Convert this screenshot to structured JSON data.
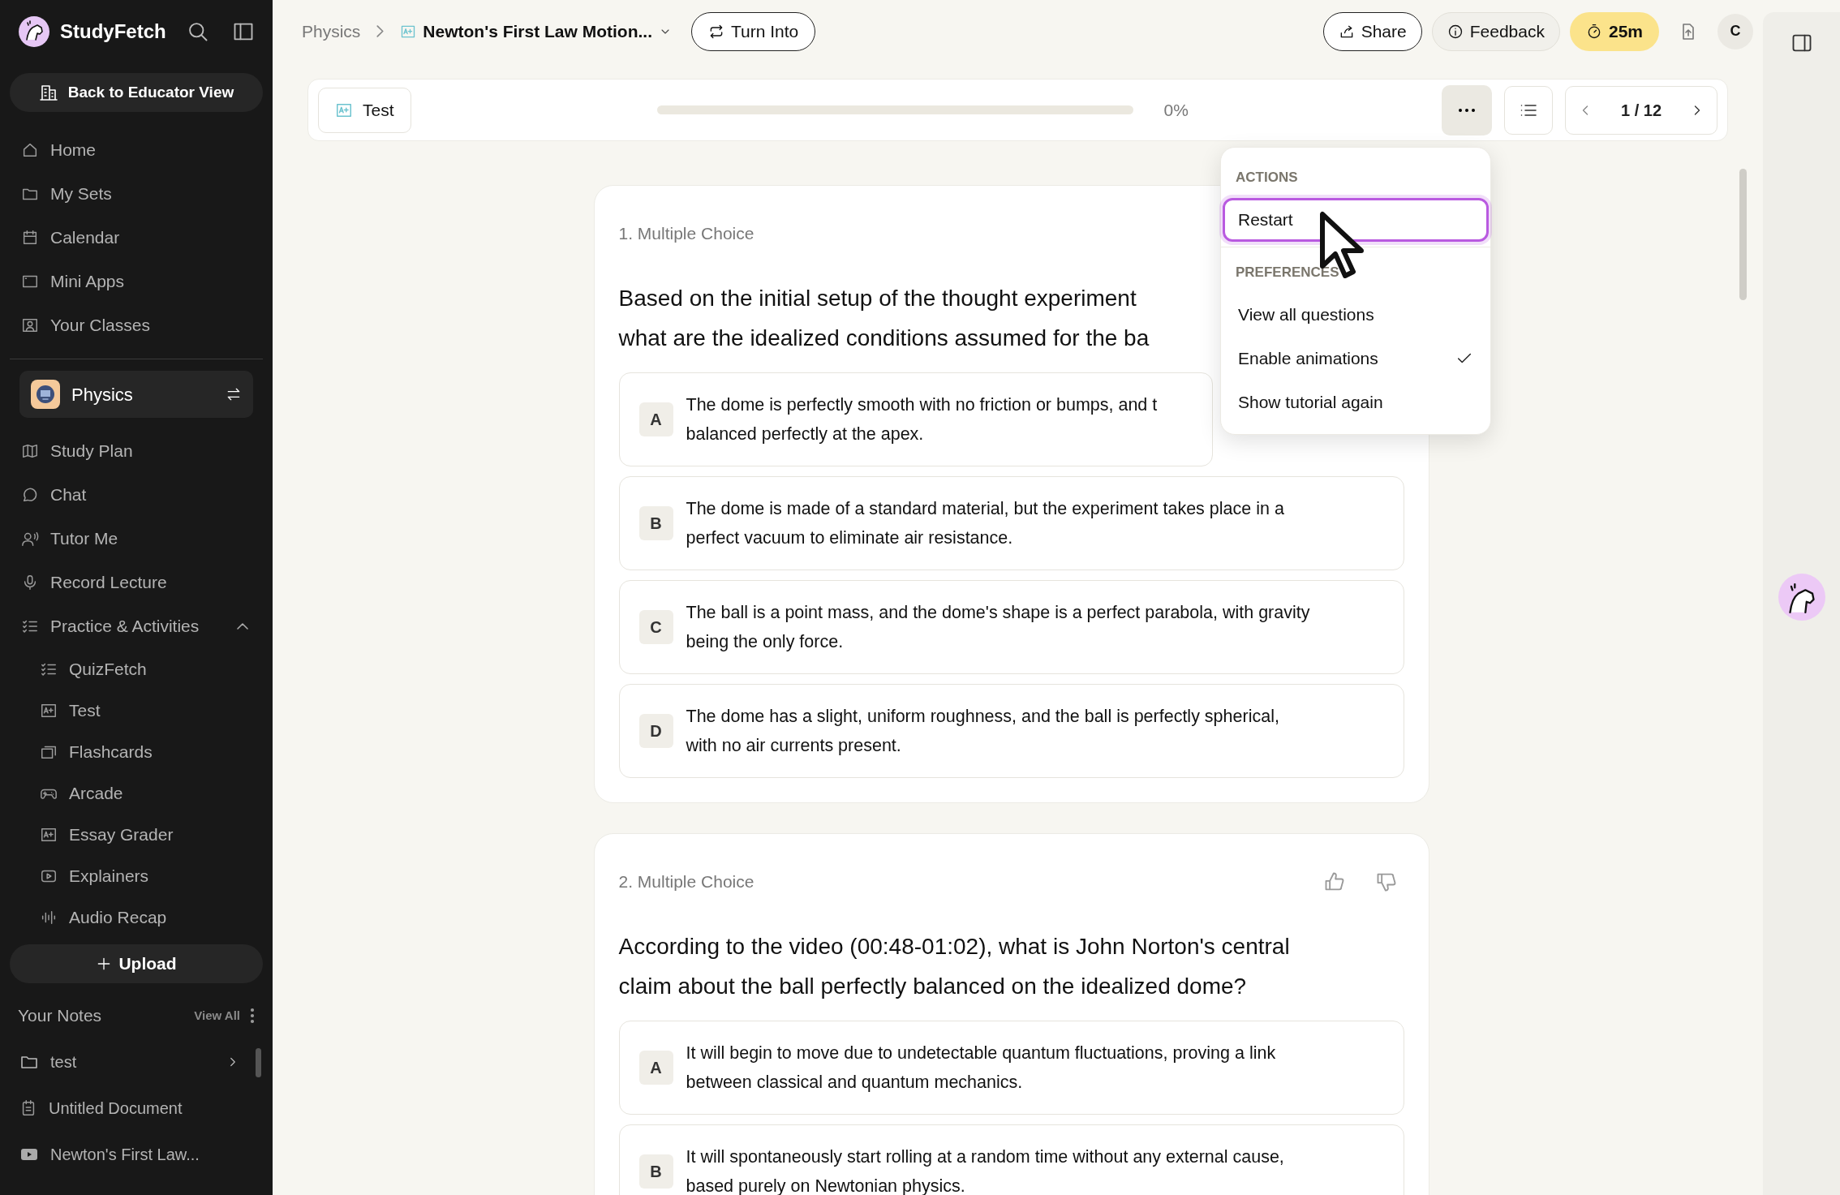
{
  "sidebar": {
    "brand": "StudyFetch",
    "educator_button": "Back to Educator View",
    "nav": [
      {
        "label": "Home"
      },
      {
        "label": "My Sets"
      },
      {
        "label": "Calendar"
      },
      {
        "label": "Mini Apps"
      },
      {
        "label": "Your Classes"
      }
    ],
    "class_card": {
      "name": "Physics"
    },
    "class_nav": [
      {
        "label": "Study Plan"
      },
      {
        "label": "Chat"
      },
      {
        "label": "Tutor Me"
      },
      {
        "label": "Record Lecture"
      },
      {
        "label": "Practice & Activities",
        "expanded": true,
        "children": [
          {
            "label": "QuizFetch"
          },
          {
            "label": "Test"
          },
          {
            "label": "Flashcards"
          },
          {
            "label": "Arcade"
          },
          {
            "label": "Essay Grader"
          },
          {
            "label": "Explainers"
          },
          {
            "label": "Audio Recap"
          }
        ]
      }
    ],
    "upload_button": "Upload",
    "notes": {
      "title": "Your Notes",
      "view_all": "View All",
      "items": [
        {
          "kind": "folder",
          "label": "test"
        },
        {
          "kind": "document",
          "label": "Untitled Document"
        },
        {
          "kind": "video",
          "label": "Newton's First Law..."
        }
      ]
    }
  },
  "top_bar": {
    "breadcrumb": [
      "Physics",
      "Newton's First Law Motion..."
    ],
    "turn_into": "Turn Into",
    "share": "Share",
    "feedback": "Feedback",
    "timer": "25m",
    "avatar": "C"
  },
  "test_header": {
    "label": "Test",
    "progress": {
      "level": 0,
      "reading": "0%"
    },
    "pager": "1 / 12"
  },
  "menu": {
    "sections": [
      {
        "heading": "ACTIONS",
        "items": [
          {
            "label": "Restart",
            "selected": true,
            "checked": false
          }
        ]
      },
      {
        "heading": "PREFERENCES",
        "items": [
          {
            "label": "View all questions",
            "selected": false,
            "checked": false
          },
          {
            "label": "Enable animations",
            "selected": false,
            "checked": true
          },
          {
            "label": "Show tutorial again",
            "selected": false,
            "checked": false
          }
        ]
      }
    ]
  },
  "questions": [
    {
      "type_label": "1. Multiple Choice",
      "lines": [
        "Based on the initial setup of the thought experiment",
        "what are the idealized conditions assumed for the ba"
      ],
      "options": [
        {
          "letter": "A",
          "lines": [
            "The dome is perfectly smooth with no friction or bumps, and t",
            "balanced perfectly at the apex."
          ]
        },
        {
          "letter": "B",
          "lines": [
            "The dome is made of a standard material, but the experiment takes place in a",
            "perfect vacuum to eliminate air resistance."
          ]
        },
        {
          "letter": "C",
          "lines": [
            "The ball is a point mass, and the dome's shape is a perfect parabola, with gravity",
            "being the only force."
          ]
        },
        {
          "letter": "D",
          "lines": [
            "The dome has a slight, uniform roughness, and the ball is perfectly spherical,",
            "with no air currents present."
          ]
        }
      ]
    },
    {
      "type_label": "2. Multiple Choice",
      "rating_buttons": true,
      "lines": [
        "According to the video (00:48-01:02), what is John Norton's central",
        "claim about the ball perfectly balanced on the idealized dome?"
      ],
      "options": [
        {
          "letter": "A",
          "lines": [
            "It will begin to move due to undetectable quantum fluctuations, proving a link",
            "between classical and quantum mechanics."
          ]
        },
        {
          "letter": "B",
          "lines": [
            "It will spontaneously start rolling at a random time without any external cause,",
            "based purely on Newtonian physics."
          ]
        }
      ]
    }
  ]
}
